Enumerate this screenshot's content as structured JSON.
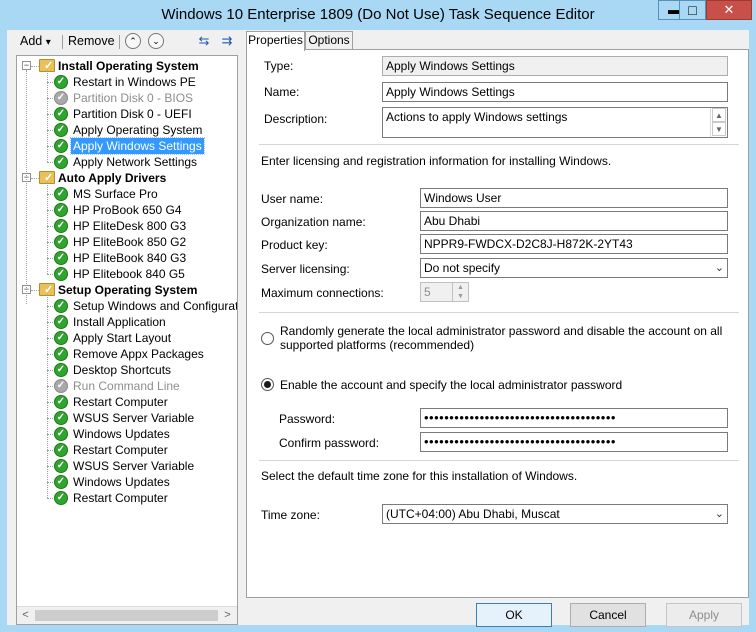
{
  "window": {
    "title": "Windows 10 Enterprise 1809 (Do Not Use) Task Sequence Editor",
    "minimize_glyph": "▬",
    "maximize_glyph": "□",
    "close_glyph": "✕"
  },
  "toolbar": {
    "add_label": "Add",
    "add_arrow": "▾",
    "remove_label": "Remove",
    "up_glyph": "⌃",
    "down_glyph": "⌄",
    "icon1_glyph": "⇆",
    "icon2_glyph": "⇉"
  },
  "tree": {
    "groups": [
      {
        "label": "Install Operating System",
        "items": [
          {
            "label": "Restart in Windows PE",
            "disabled": false,
            "selected": false
          },
          {
            "label": "Partition Disk 0 - BIOS",
            "disabled": true,
            "selected": false
          },
          {
            "label": "Partition Disk 0 - UEFI",
            "disabled": false,
            "selected": false
          },
          {
            "label": "Apply Operating System",
            "disabled": false,
            "selected": false
          },
          {
            "label": "Apply Windows Settings",
            "disabled": false,
            "selected": true
          },
          {
            "label": "Apply Network Settings",
            "disabled": false,
            "selected": false
          }
        ]
      },
      {
        "label": "Auto Apply Drivers",
        "items": [
          {
            "label": "MS Surface Pro",
            "disabled": false,
            "selected": false
          },
          {
            "label": "HP ProBook 650 G4",
            "disabled": false,
            "selected": false
          },
          {
            "label": "HP EliteDesk 800 G3",
            "disabled": false,
            "selected": false
          },
          {
            "label": "HP EliteBook 850 G2",
            "disabled": false,
            "selected": false
          },
          {
            "label": "HP EliteBook 840 G3",
            "disabled": false,
            "selected": false
          },
          {
            "label": "HP Elitebook 840 G5",
            "disabled": false,
            "selected": false
          }
        ]
      },
      {
        "label": "Setup Operating System",
        "items": [
          {
            "label": "Setup Windows and Configuration",
            "disabled": false,
            "selected": false
          },
          {
            "label": "Install Application",
            "disabled": false,
            "selected": false
          },
          {
            "label": "Apply Start Layout",
            "disabled": false,
            "selected": false
          },
          {
            "label": "Remove Appx Packages",
            "disabled": false,
            "selected": false
          },
          {
            "label": "Desktop Shortcuts",
            "disabled": false,
            "selected": false
          },
          {
            "label": "Run Command Line",
            "disabled": true,
            "selected": false
          },
          {
            "label": "Restart Computer",
            "disabled": false,
            "selected": false
          },
          {
            "label": "WSUS Server Variable",
            "disabled": false,
            "selected": false
          },
          {
            "label": "Windows Updates",
            "disabled": false,
            "selected": false
          },
          {
            "label": "Restart Computer",
            "disabled": false,
            "selected": false
          },
          {
            "label": "WSUS Server Variable",
            "disabled": false,
            "selected": false
          },
          {
            "label": "Windows Updates",
            "disabled": false,
            "selected": false
          },
          {
            "label": "Restart Computer",
            "disabled": false,
            "selected": false
          }
        ]
      }
    ],
    "scroll_left": "<",
    "scroll_right": ">"
  },
  "tabs": [
    {
      "label": "Properties",
      "active": true
    },
    {
      "label": "Options",
      "active": false
    }
  ],
  "properties": {
    "type_label": "Type:",
    "type_value": "Apply Windows Settings",
    "name_label": "Name:",
    "name_value": "Apply Windows Settings",
    "description_label": "Description:",
    "description_value": "Actions to apply Windows settings",
    "licensing_intro": "Enter licensing and registration information for installing Windows.",
    "user_name_label": "User name:",
    "user_name_value": "Windows User",
    "org_label": "Organization name:",
    "org_value": "Abu Dhabi",
    "product_key_label": "Product key:",
    "product_key_value": "NPPR9-FWDCX-D2C8J-H872K-2YT43",
    "server_licensing_label": "Server licensing:",
    "server_licensing_value": "Do not specify",
    "max_conn_label": "Maximum connections:",
    "max_conn_value": "5",
    "radio_random_label": "Randomly generate the local administrator password and disable the account on all supported platforms (recommended)",
    "radio_enable_label": "Enable the account and specify the local administrator password",
    "password_label": "Password:",
    "password_value": "••••••••••••••••••••••••••••••••••••••",
    "confirm_label": "Confirm password:",
    "confirm_value": "••••••••••••••••••••••••••••••••••••••",
    "timezone_intro": "Select the default time zone for this installation of Windows.",
    "timezone_label": "Time zone:",
    "timezone_value": "(UTC+04:00) Abu Dhabi, Muscat",
    "dropdown_glyph": "⌄"
  },
  "buttons": {
    "ok": "OK",
    "cancel": "Cancel",
    "apply": "Apply"
  }
}
